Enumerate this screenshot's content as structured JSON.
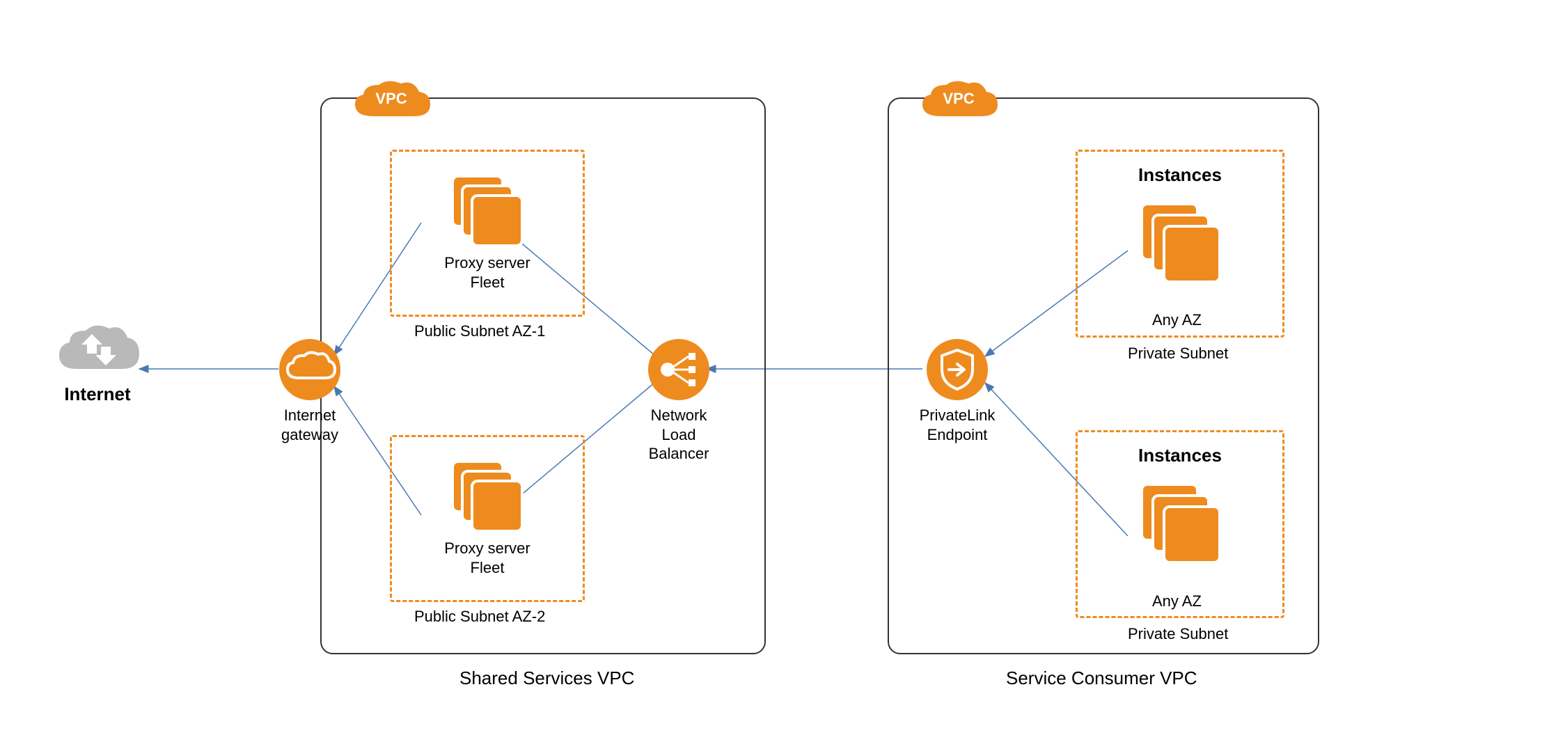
{
  "internet": {
    "label": "Internet"
  },
  "igw": {
    "label_line1": "Internet",
    "label_line2": "gateway"
  },
  "nlb": {
    "label_line1": "Network Load",
    "label_line2": "Balancer"
  },
  "privatelink": {
    "label_line1": "PrivateLink",
    "label_line2": "Endpoint"
  },
  "vpc_left": {
    "badge": "VPC",
    "title": "Shared Services VPC",
    "subnet1": {
      "title": "Public Subnet AZ-1",
      "box_label_line1": "Proxy server",
      "box_label_line2": "Fleet"
    },
    "subnet2": {
      "title": "Public Subnet AZ-2",
      "box_label_line1": "Proxy server",
      "box_label_line2": "Fleet"
    }
  },
  "vpc_right": {
    "badge": "VPC",
    "title": "Service Consumer VPC",
    "subnet1": {
      "title": "Private Subnet",
      "in_title": "Instances",
      "az": "Any AZ"
    },
    "subnet2": {
      "title": "Private Subnet",
      "in_title": "Instances",
      "az": "Any AZ"
    }
  }
}
